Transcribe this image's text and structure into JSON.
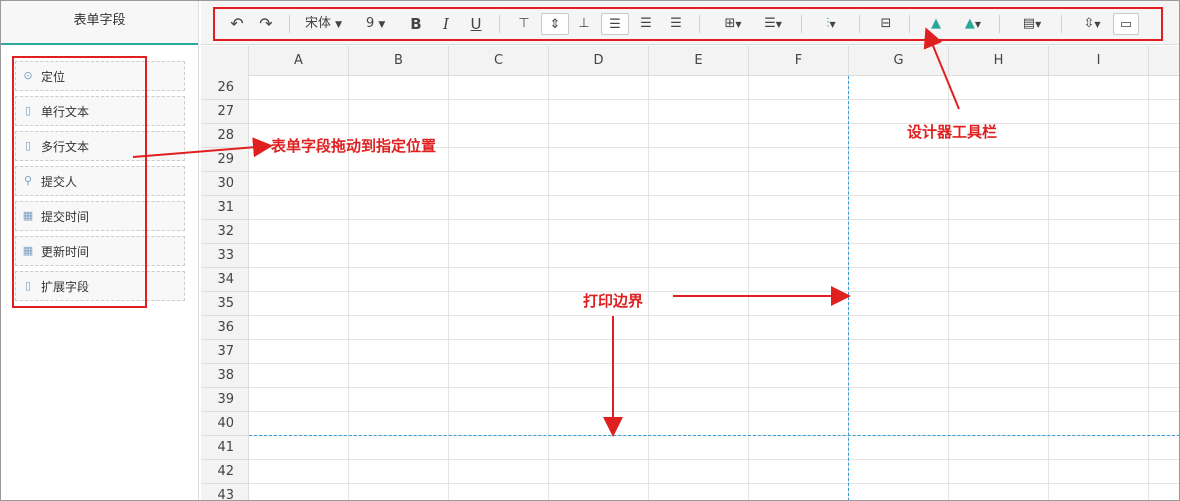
{
  "sidebar": {
    "title": "表单字段",
    "items": [
      {
        "label": "定位",
        "icon": "location-icon"
      },
      {
        "label": "单行文本",
        "icon": "text-field-icon"
      },
      {
        "label": "多行文本",
        "icon": "textarea-icon"
      },
      {
        "label": "提交人",
        "icon": "user-icon"
      },
      {
        "label": "提交时间",
        "icon": "calendar-icon"
      },
      {
        "label": "更新时间",
        "icon": "calendar-icon"
      },
      {
        "label": "扩展字段",
        "icon": "text-field-icon"
      }
    ]
  },
  "toolbar": {
    "font_family": "宋体",
    "font_size": "9",
    "bold": "B",
    "italic": "I",
    "underline": "U"
  },
  "grid": {
    "columns": [
      "A",
      "B",
      "C",
      "D",
      "E",
      "F",
      "G",
      "H",
      "I"
    ],
    "rows": [
      "26",
      "27",
      "28",
      "29",
      "30",
      "31",
      "32",
      "33",
      "34",
      "35",
      "36",
      "37",
      "38",
      "39",
      "40",
      "41",
      "42",
      "43"
    ]
  },
  "annotations": {
    "drag_hint": "表单字段拖动到指定位置",
    "toolbar_hint": "设计器工具栏",
    "print_border": "打印边界"
  },
  "colors": {
    "annotation": "#e02020",
    "accent": "#2aa89a",
    "print_border": "#3a9ad6"
  }
}
